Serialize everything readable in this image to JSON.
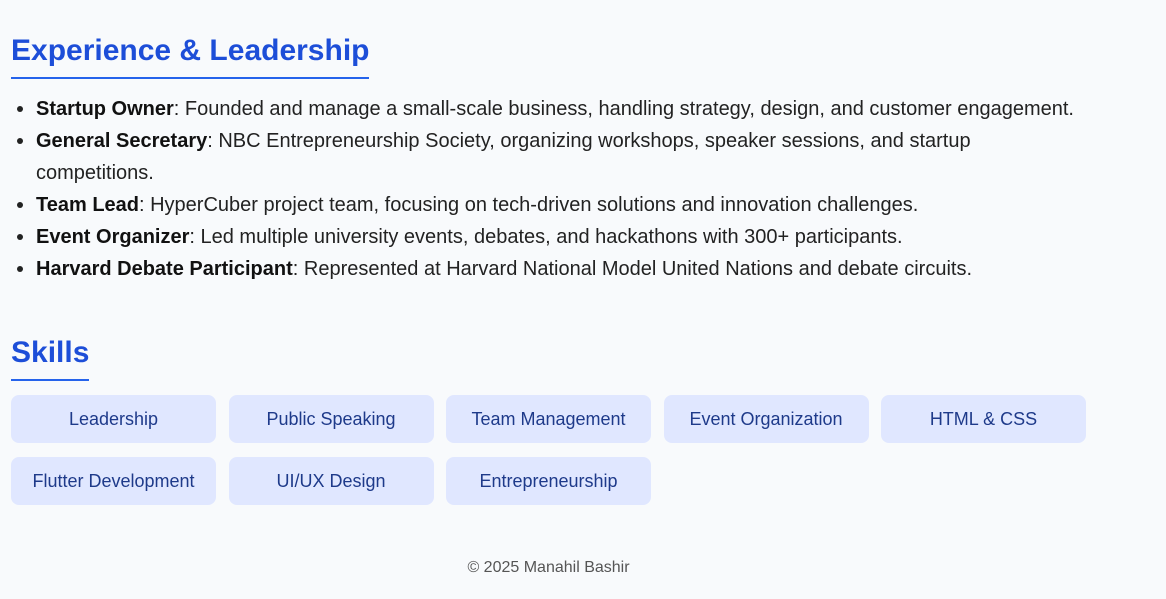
{
  "experience": {
    "title": "Experience & Leadership",
    "items": [
      {
        "role": "Startup Owner",
        "desc": ": Founded and manage a small-scale business, handling strategy, design, and customer engagement."
      },
      {
        "role": "General Secretary",
        "desc": ": NBC Entrepreneurship Society, organizing workshops, speaker sessions, and startup competitions."
      },
      {
        "role": "Team Lead",
        "desc": ": HyperCuber project team, focusing on tech-driven solutions and innovation challenges."
      },
      {
        "role": "Event Organizer",
        "desc": ": Led multiple university events, debates, and hackathons with 300+ participants."
      },
      {
        "role": "Harvard Debate Participant",
        "desc": ": Represented at Harvard National Model United Nations and debate circuits."
      }
    ]
  },
  "skills": {
    "title": "Skills",
    "items": [
      "Leadership",
      "Public Speaking",
      "Team Management",
      "Event Organization",
      "HTML & CSS",
      "Flutter Development",
      "UI/UX Design",
      "Entrepreneurship"
    ]
  },
  "footer": {
    "text": "© 2025 Manahil Bashir"
  },
  "colors": {
    "heading": "#1d4ed8",
    "chip_bg": "#e0e7ff",
    "chip_text": "#1e3a8a",
    "page_bg": "#f8fafc"
  }
}
